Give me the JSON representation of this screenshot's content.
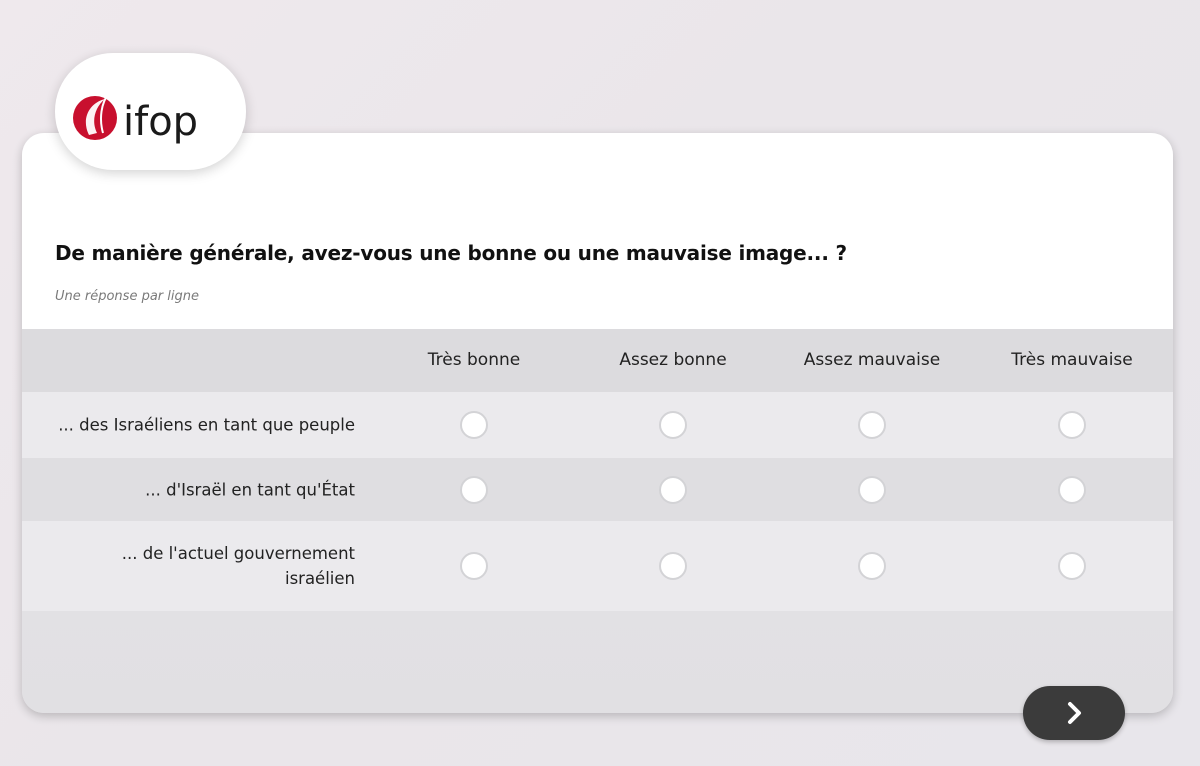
{
  "brand": {
    "logo_text": "ifop",
    "logo_color": "#c8102e"
  },
  "question": {
    "title": "De manière générale, avez-vous une bonne ou une mauvaise image... ?",
    "instruction": "Une réponse par ligne"
  },
  "columns": [
    "Très bonne",
    "Assez bonne",
    "Assez mauvaise",
    "Très mauvaise"
  ],
  "rows": [
    {
      "label": "... des Israéliens en tant que peuple",
      "selected": null
    },
    {
      "label": "... d'Israël en tant qu'État",
      "selected": null
    },
    {
      "label": "... de l'actuel gouvernement israélien",
      "selected": null
    }
  ],
  "navigation": {
    "next_icon": "chevron-right-icon",
    "next_color": "#3b3b3b"
  }
}
